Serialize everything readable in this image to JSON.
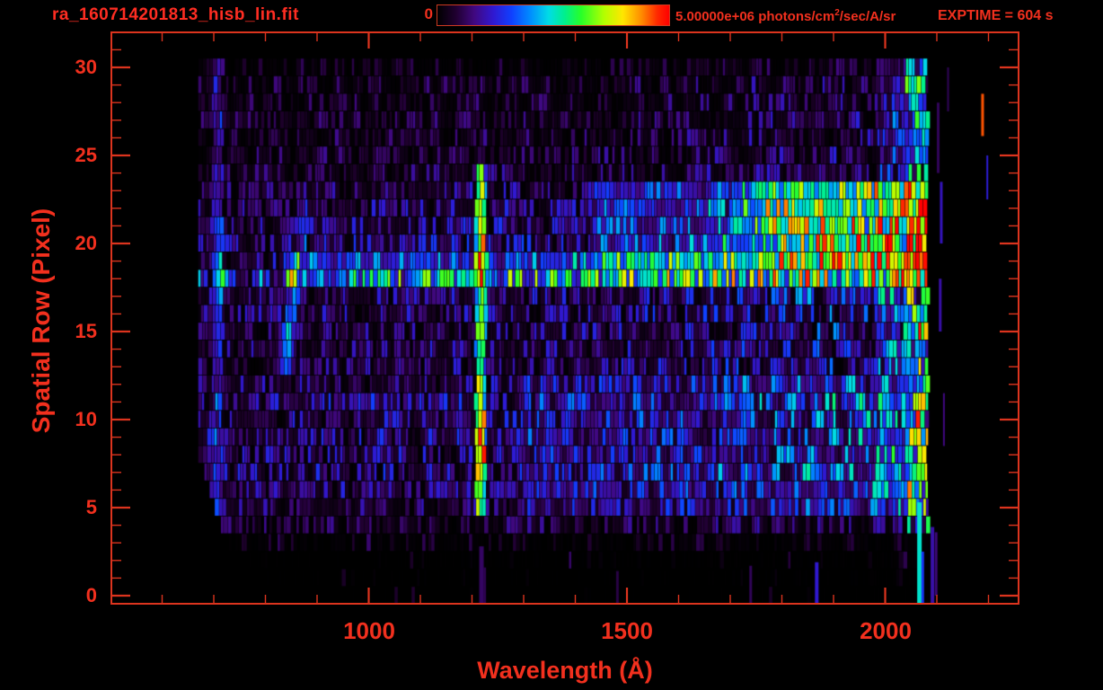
{
  "header": {
    "title": "ra_160714201813_hisb_lin.fit",
    "colorbar": {
      "min_label": "0",
      "max_value": "5.00000e+06 ",
      "units_prefix": "photons/cm",
      "units_sup": "2",
      "units_suffix": "/sec/A/sr"
    },
    "exptime": "EXPTIME = 604 s"
  },
  "colors": {
    "background": "#000000",
    "text_red": "#f2301e",
    "title_red": "#ff2d22",
    "axis_red": "#dc341e"
  },
  "chart_data": {
    "type": "heatmap",
    "title": "ra_160714201813_hisb_lin.fit",
    "xlabel": "Wavelength (Å)",
    "ylabel": "Spatial Row (Pixel)",
    "xlim": [
      500,
      2260
    ],
    "ylim": [
      -0.5,
      32
    ],
    "x_major_ticks": [
      1000,
      1500,
      2000
    ],
    "x_minor_step": 100,
    "y_major_ticks": [
      0,
      5,
      10,
      15,
      20,
      25,
      30
    ],
    "y_minor_step": 1,
    "colorbar": {
      "min": 0,
      "max": 5000000,
      "max_label": "5.00000e+06",
      "units": "photons/cm^2/sec/A/sr"
    },
    "exposure_time_s": 604,
    "grid": false,
    "rows": 31,
    "data_lambda_range": [
      670,
      2080
    ],
    "seed": 20160714,
    "colormap_stops": [
      [
        0.0,
        [
          0,
          0,
          0
        ]
      ],
      [
        0.08,
        [
          32,
          0,
          48
        ]
      ],
      [
        0.16,
        [
          64,
          8,
          128
        ]
      ],
      [
        0.24,
        [
          48,
          24,
          208
        ]
      ],
      [
        0.32,
        [
          16,
          64,
          255
        ]
      ],
      [
        0.4,
        [
          0,
          140,
          255
        ]
      ],
      [
        0.48,
        [
          0,
          220,
          230
        ]
      ],
      [
        0.55,
        [
          0,
          240,
          140
        ]
      ],
      [
        0.62,
        [
          40,
          255,
          40
        ]
      ],
      [
        0.72,
        [
          180,
          255,
          0
        ]
      ],
      [
        0.8,
        [
          255,
          230,
          0
        ]
      ],
      [
        0.88,
        [
          255,
          140,
          0
        ]
      ],
      [
        0.95,
        [
          255,
          40,
          0
        ]
      ],
      [
        1.0,
        [
          255,
          0,
          0
        ]
      ]
    ],
    "noise": {
      "floor": 0.3,
      "range": 1.7,
      "power": 1.6,
      "gap_factor": 0.12,
      "speck_prob": 0.035
    },
    "row_profiles": [
      [
        0.004,
        0.004,
        0.01
      ],
      [
        0.006,
        0.008,
        0.02
      ],
      [
        0.01,
        0.012,
        0.03
      ],
      [
        0.05,
        0.05,
        0.06
      ],
      [
        0.09,
        0.1,
        0.13
      ],
      [
        0.11,
        0.13,
        0.22
      ],
      [
        0.13,
        0.15,
        0.26
      ],
      [
        0.15,
        0.17,
        0.28
      ],
      [
        0.13,
        0.16,
        0.26
      ],
      [
        0.14,
        0.17,
        0.27
      ],
      [
        0.13,
        0.16,
        0.26
      ],
      [
        0.15,
        0.17,
        0.28
      ],
      [
        0.12,
        0.15,
        0.25
      ],
      [
        0.11,
        0.14,
        0.24
      ],
      [
        0.12,
        0.15,
        0.25
      ],
      [
        0.11,
        0.14,
        0.24
      ],
      [
        0.12,
        0.15,
        0.25
      ],
      [
        0.12,
        0.16,
        0.27
      ],
      [
        0.26,
        0.32,
        0.4
      ],
      [
        0.14,
        0.18,
        0.34
      ],
      [
        0.13,
        0.18,
        0.38
      ],
      [
        0.12,
        0.17,
        0.38
      ],
      [
        0.11,
        0.16,
        0.35
      ],
      [
        0.1,
        0.14,
        0.26
      ],
      [
        0.09,
        0.11,
        0.16
      ],
      [
        0.085,
        0.1,
        0.15
      ],
      [
        0.08,
        0.1,
        0.14
      ],
      [
        0.08,
        0.095,
        0.14
      ],
      [
        0.075,
        0.09,
        0.13
      ],
      [
        0.075,
        0.09,
        0.14
      ],
      [
        0.05,
        0.06,
        0.09
      ]
    ],
    "row_gap_prob": [
      0.93,
      0.91,
      0.88,
      0.72,
      0.38,
      0.18,
      0.16,
      0.16,
      0.17,
      0.16,
      0.17,
      0.16,
      0.18,
      0.19,
      0.18,
      0.19,
      0.18,
      0.17,
      0.1,
      0.15,
      0.14,
      0.14,
      0.15,
      0.17,
      0.28,
      0.3,
      0.31,
      0.32,
      0.4,
      0.38,
      0.55
    ],
    "row_lambda_min": [
      850,
      800,
      760,
      728,
      714,
      702,
      692,
      682,
      670,
      670,
      670,
      670,
      670,
      670,
      670,
      670,
      670,
      670,
      670,
      670,
      670,
      670,
      670,
      670,
      670,
      670,
      670,
      670,
      670,
      670,
      670
    ],
    "features": [
      {
        "name": "lyman-alpha-line",
        "l0": 1203,
        "l1": 1225,
        "r0": 4.6,
        "r1": 24.0,
        "add": 0.3
      },
      {
        "name": "lyman-alpha-core",
        "l0": 1207,
        "l1": 1220,
        "r0": 4.6,
        "r1": 24.0,
        "add": 0.17
      },
      {
        "name": "lyman-alpha-lower-boost",
        "l0": 1204,
        "l1": 1223,
        "r0": 4.6,
        "r1": 11.6,
        "add": 0.13
      },
      {
        "name": "lyman-alpha-upper-boost",
        "l0": 1205,
        "l1": 1223,
        "r0": 19.4,
        "r1": 23.9,
        "add": 0.11
      },
      {
        "name": "airglow-row-band",
        "l0": 830,
        "l1": 2082,
        "r0": 17.9,
        "r1": 19.05,
        "add": 0.12,
        "rnd": 0.06
      },
      {
        "name": "airglow-row-band-right",
        "l0": 1450,
        "l1": 2082,
        "r0": 17.9,
        "r1": 19.05,
        "add": 0.07
      },
      {
        "name": "continuum-ramp",
        "l0": 1430,
        "l1": 1760,
        "r0": 19.4,
        "r1": 23.3,
        "add": 0.08,
        "rnd": 0.08
      },
      {
        "name": "continuum-bright",
        "l0": 1760,
        "l1": 2082,
        "r0": 19.4,
        "r1": 23.3,
        "add": 0.2,
        "rnd": 0.1
      },
      {
        "name": "continuum-core",
        "l0": 1700,
        "l1": 2082,
        "r0": 19.9,
        "r1": 22.6,
        "add": 0.1
      },
      {
        "name": "diagonal-streak-1",
        "l0": 826,
        "l1": 848,
        "r0": 12.6,
        "r1": 15.2,
        "add": 0.2
      },
      {
        "name": "diagonal-streak-2",
        "l0": 836,
        "l1": 856,
        "r0": 15.2,
        "r1": 17.4,
        "add": 0.2
      },
      {
        "name": "diagonal-streak-3",
        "l0": 846,
        "l1": 866,
        "r0": 17.4,
        "r1": 19.4,
        "add": 0.16
      },
      {
        "name": "diagonal-streak-4",
        "l0": 856,
        "l1": 878,
        "r0": 19.4,
        "r1": 21.8,
        "add": 0.11
      },
      {
        "name": "left-edge-column",
        "l0": 696,
        "l1": 714,
        "r0": 2.6,
        "r1": 30.5,
        "add": 0.09,
        "rnd": 0.12
      },
      {
        "name": "right-edge-speckle",
        "l0": 2038,
        "l1": 2082,
        "r0": 3.6,
        "r1": 30.5,
        "rnd": 0.55
      },
      {
        "name": "right-edge-inner",
        "l0": 1980,
        "l1": 2038,
        "r0": 4.6,
        "r1": 30.5,
        "rnd": 0.18
      },
      {
        "name": "blue-wash-right-lower",
        "l0": 1300,
        "l1": 2082,
        "r0": 4.6,
        "r1": 12.4,
        "add": 0.03,
        "rnd": 0.05
      }
    ],
    "stray_columns": [
      {
        "l": 1214,
        "w": 5,
        "r0": -0.45,
        "r1": 2.3,
        "v": 0.13
      },
      {
        "l": 1222,
        "w": 3,
        "r0": -0.45,
        "r1": 1.1,
        "v": 0.11
      },
      {
        "l": 1479,
        "w": 3,
        "r0": -0.4,
        "r1": 0.9,
        "v": 0.1
      },
      {
        "l": 1737,
        "w": 3,
        "r0": -0.4,
        "r1": 1.2,
        "v": 0.12
      },
      {
        "l": 1864,
        "w": 4,
        "r0": -0.4,
        "r1": 1.4,
        "v": 0.24
      },
      {
        "l": 2062,
        "w": 5,
        "r0": -0.45,
        "r1": 4.8,
        "v": 0.5
      },
      {
        "l": 2070,
        "w": 3,
        "r0": -0.45,
        "r1": 2.0,
        "v": 0.3
      },
      {
        "l": 2088,
        "w": 4,
        "r0": -0.45,
        "r1": 3.4,
        "v": 0.2
      },
      {
        "l": 2096,
        "w": 3,
        "r0": 0.5,
        "r1": 3.1,
        "v": 0.15
      },
      {
        "l": 2100,
        "w": 3,
        "r0": 24.5,
        "r1": 27.5,
        "v": 0.12
      },
      {
        "l": 2106,
        "w": 3,
        "r0": 20.5,
        "r1": 23.0,
        "v": 0.22
      },
      {
        "l": 2104,
        "w": 3,
        "r0": 15.5,
        "r1": 17.5,
        "v": 0.2
      },
      {
        "l": 2112,
        "w": 2,
        "r0": 9.0,
        "r1": 11.0,
        "v": 0.16
      },
      {
        "l": 2120,
        "w": 2,
        "r0": 28.0,
        "r1": 29.5,
        "v": 0.12
      },
      {
        "l": 2186,
        "w": 3,
        "r0": 26.6,
        "r1": 28.0,
        "v": 0.92
      },
      {
        "l": 2196,
        "w": 2,
        "r0": 23.0,
        "r1": 24.5,
        "v": 0.25
      }
    ]
  }
}
